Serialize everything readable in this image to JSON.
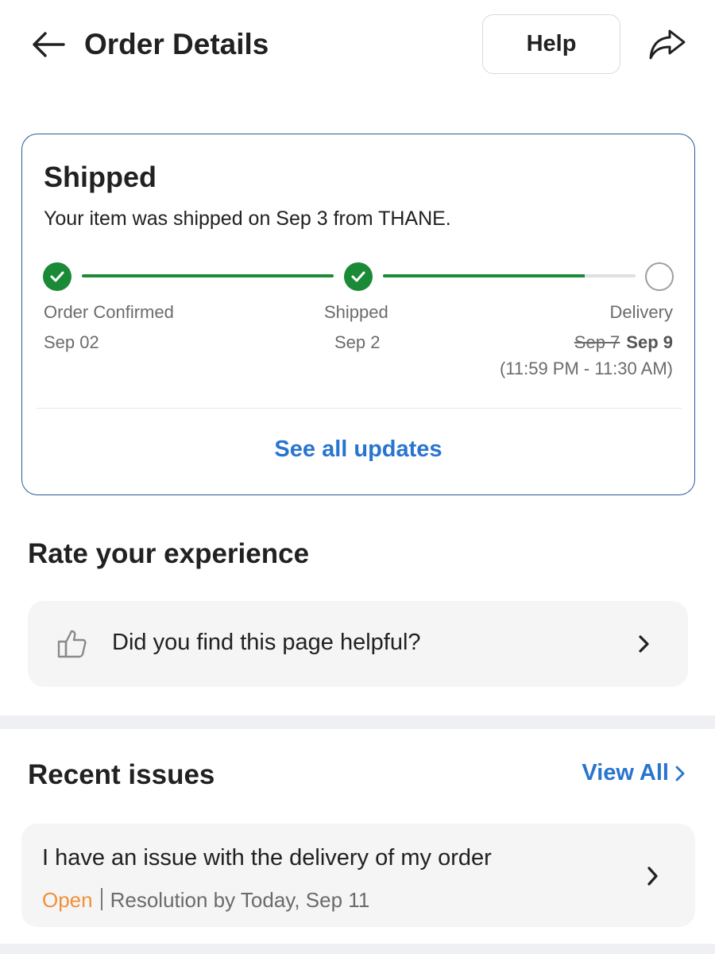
{
  "header": {
    "title": "Order Details",
    "help_label": "Help"
  },
  "status": {
    "title": "Shipped",
    "description": "Your item was shipped on Sep 3 from THANE.",
    "progress_fraction_segment2": 0.8,
    "steps": [
      {
        "label": "Order Confirmed",
        "date": "Sep 02",
        "done": true
      },
      {
        "label": "Shipped",
        "date": "Sep 2",
        "done": true
      },
      {
        "label": "Delivery",
        "old_date": "Sep 7",
        "date": "Sep 9",
        "window": "(11:59 PM - 11:30 AM)",
        "done": false
      }
    ],
    "see_all_label": "See all updates"
  },
  "rate": {
    "title": "Rate your experience",
    "question": "Did you find this page helpful?"
  },
  "issues": {
    "title": "Recent issues",
    "view_all_label": "View All",
    "items": [
      {
        "text": "I have an issue with the delivery of my order",
        "status": "Open",
        "resolution": "Resolution by Today, Sep 11"
      }
    ]
  },
  "colors": {
    "accent": "#2874d0",
    "success": "#1a8a36",
    "card_border": "#2a5a9f",
    "open_status": "#f0913a"
  },
  "icons": [
    "back-arrow-icon",
    "share-icon",
    "check-icon",
    "thumbs-up-icon",
    "chevron-right-icon"
  ]
}
